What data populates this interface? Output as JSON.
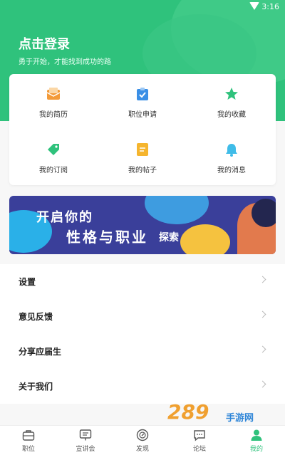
{
  "status_bar": {
    "time": "3:16"
  },
  "header": {
    "title": "点击登录",
    "subtitle": "勇于开始，才能找到成功的路"
  },
  "grid": [
    {
      "label": "我的简历",
      "icon": "resume-icon",
      "color": "#f39b3a"
    },
    {
      "label": "职位申请",
      "icon": "clipboard-check-icon",
      "color": "#3a8fe6"
    },
    {
      "label": "我的收藏",
      "icon": "star-icon",
      "color": "#2fc27c"
    },
    {
      "label": "我的订阅",
      "icon": "tag-icon",
      "color": "#2fc27c"
    },
    {
      "label": "我的帖子",
      "icon": "post-icon",
      "color": "#f5b52e"
    },
    {
      "label": "我的消息",
      "icon": "bell-icon",
      "color": "#3fbce8"
    }
  ],
  "banner": {
    "line1": "开启你的",
    "line2": "性格与职业",
    "line3": "探索"
  },
  "list": [
    {
      "label": "设置"
    },
    {
      "label": "意见反馈"
    },
    {
      "label": "分享应届生"
    },
    {
      "label": "关于我们"
    }
  ],
  "tabs": [
    {
      "label": "职位",
      "icon": "briefcase-icon"
    },
    {
      "label": "宣讲会",
      "icon": "presentation-icon"
    },
    {
      "label": "发现",
      "icon": "compass-icon"
    },
    {
      "label": "论坛",
      "icon": "chat-icon"
    },
    {
      "label": "我的",
      "icon": "person-icon",
      "active": true
    }
  ],
  "watermark": {
    "brand": "289",
    "text": "手游网"
  },
  "colors": {
    "accent": "#2fc27c",
    "banner_bg": "#3a3f9a"
  }
}
